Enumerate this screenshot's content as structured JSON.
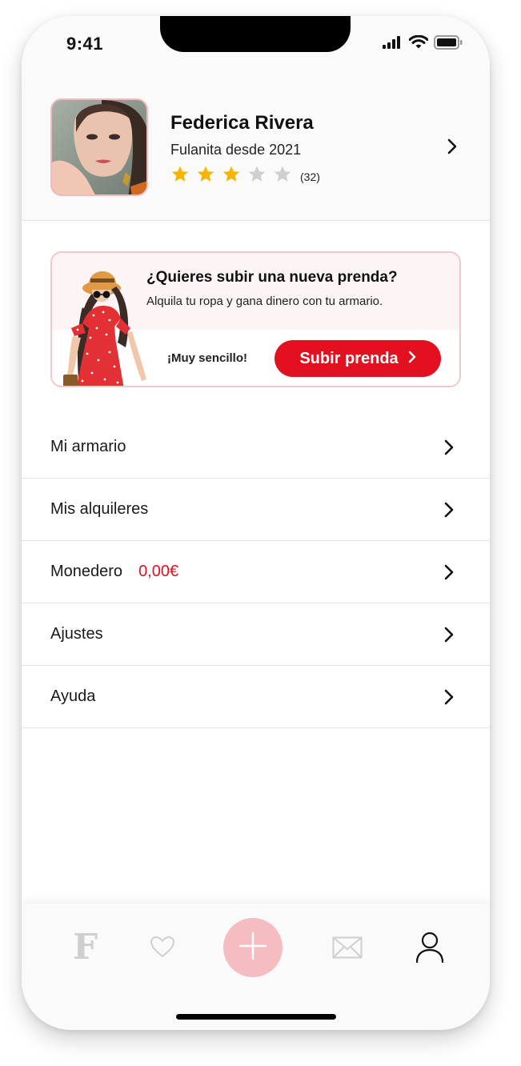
{
  "status_bar": {
    "time": "9:41"
  },
  "profile": {
    "name": "Federica Rivera",
    "member_since": "Fulanita desde 2021",
    "rating_stars": 3,
    "rating_max": 5,
    "rating_count": "(32)"
  },
  "promo": {
    "title": "¿Quieres subir una nueva prenda?",
    "subtitle": "Alquila tu ropa y gana dinero con tu armario.",
    "easy_text": "¡Muy sencillo!",
    "button_label": "Subir prenda"
  },
  "menu": {
    "items": [
      {
        "label": "Mi armario"
      },
      {
        "label": "Mis alquileres"
      },
      {
        "label": "Monedero",
        "value": "0,00€"
      },
      {
        "label": "Ajustes"
      },
      {
        "label": "Ayuda"
      }
    ]
  },
  "tabbar": {
    "home_logo": "F",
    "active_tab": "profile"
  },
  "colors": {
    "accent": "#e3101f",
    "accent_soft": "#f5bcc2",
    "star": "#f7b500",
    "star_empty": "#cfcfcf"
  },
  "icons": [
    "signal-icon",
    "wifi-icon",
    "battery-icon",
    "star-icon",
    "chevron-right-icon",
    "heart-icon",
    "plus-icon",
    "mail-icon",
    "user-icon"
  ]
}
